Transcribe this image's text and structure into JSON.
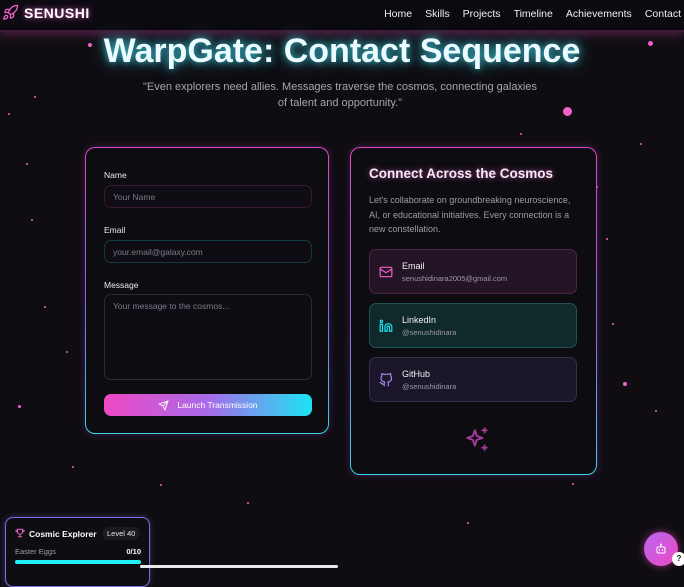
{
  "brand": {
    "name": "SENUSHI",
    "icon": "rocket-icon"
  },
  "nav": [
    {
      "label": "Home"
    },
    {
      "label": "Skills"
    },
    {
      "label": "Projects"
    },
    {
      "label": "Timeline"
    },
    {
      "label": "Achievements"
    },
    {
      "label": "Contact"
    }
  ],
  "hero": {
    "title": "WarpGate: Contact Sequence",
    "subtitle": "\"Even explorers need allies. Messages traverse the cosmos, connecting galaxies of talent and opportunity.\""
  },
  "form": {
    "name_label": "Name",
    "name_placeholder": "Your Name",
    "email_label": "Email",
    "email_placeholder": "your.email@galaxy.com",
    "message_label": "Message",
    "message_placeholder": "Your message to the cosmos...",
    "submit_label": "Launch Transmission",
    "submit_icon": "send-icon"
  },
  "connect": {
    "title": "Connect Across the Cosmos",
    "text": "Let's collaborate on groundbreaking neuroscience, AI, or educational initiatives. Every connection is a new constellation.",
    "items": [
      {
        "label": "Email",
        "value": "senushidinara2005@gmail.com",
        "icon": "mail-icon"
      },
      {
        "label": "LinkedIn",
        "value": "@senushidinara",
        "icon": "linkedin-icon"
      },
      {
        "label": "GitHub",
        "value": "@senushidinara",
        "icon": "github-icon"
      }
    ]
  },
  "explorer": {
    "title": "Cosmic Explorer",
    "level": "Level 40",
    "eggs_label": "Easter Eggs",
    "eggs_count": "0/10",
    "eggs_progress": 0.0,
    "icon": "trophy-icon"
  },
  "help_label": "?",
  "colors": {
    "background": "#0f0d12",
    "pink": "#f062c9",
    "cyan": "#1ce4f5",
    "purple": "#8c68e8"
  }
}
